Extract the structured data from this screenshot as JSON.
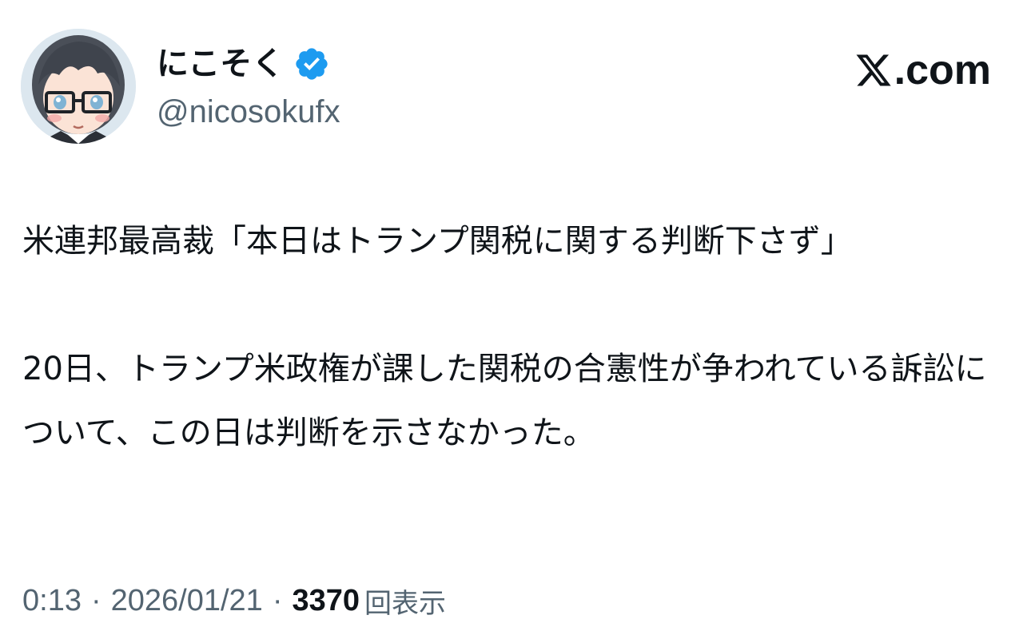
{
  "author": {
    "display_name": "にこそく",
    "handle": "@nicosokufx",
    "verified": true,
    "avatar_icon": "anime-avatar-glasses-icon",
    "verified_icon": "verified-badge-icon"
  },
  "site": {
    "logo_icon": "x-logo-icon",
    "domain": ".com"
  },
  "tweet": {
    "paragraph_1": "米連邦最高裁「本日はトランプ関税に関する判断下さず」",
    "paragraph_2": "20日、トランプ米政権が課した関税の合憲性が争われている訴訟について、この日は判断を示さなかった。"
  },
  "meta": {
    "time": "0:13",
    "separator": "·",
    "date": "2026/01/21",
    "views_count": "3370",
    "views_label": "回表示"
  },
  "colors": {
    "text_primary": "#0f1419",
    "text_secondary": "#536471",
    "verified_blue": "#1d9bf0",
    "background": "#ffffff"
  }
}
